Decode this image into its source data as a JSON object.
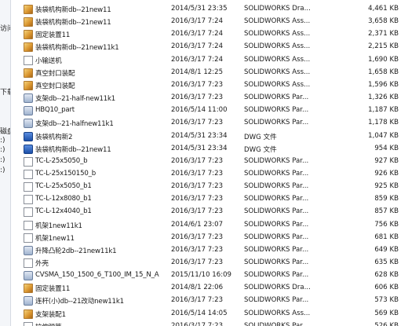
{
  "nav": {
    "items": [
      "访问",
      "下载",
      "磁盘",
      ":)",
      ":)",
      ":)",
      ":)"
    ]
  },
  "colors": {
    "selection": "#cce8ff",
    "nav_bg": "#f4f6f9"
  },
  "files": [
    {
      "name": "装袋机构新db--21new11",
      "date": "2014/5/31 23:35",
      "type": "SOLIDWORKS Dra...",
      "size": "4,461 KB",
      "icon": "solidworks-drawing-icon"
    },
    {
      "name": "装袋机构新db--21new11",
      "date": "2016/3/17 7:24",
      "type": "SOLIDWORKS Ass...",
      "size": "3,658 KB",
      "icon": "solidworks-assembly-icon"
    },
    {
      "name": "固定装置11",
      "date": "2016/3/17 7:24",
      "type": "SOLIDWORKS Ass...",
      "size": "2,371 KB",
      "icon": "solidworks-assembly-icon"
    },
    {
      "name": "装袋机构新db--21new11k1",
      "date": "2016/3/17 7:24",
      "type": "SOLIDWORKS Ass...",
      "size": "2,215 KB",
      "icon": "solidworks-assembly-icon"
    },
    {
      "name": "小输送机",
      "date": "2016/3/17 7:24",
      "type": "SOLIDWORKS Ass...",
      "size": "1,690 KB",
      "icon": "document-icon"
    },
    {
      "name": "真空封口装配",
      "date": "2014/8/1 12:25",
      "type": "SOLIDWORKS Ass...",
      "size": "1,658 KB",
      "icon": "solidworks-assembly-icon"
    },
    {
      "name": "真空封口装配",
      "date": "2016/3/17 7:23",
      "type": "SOLIDWORKS Ass...",
      "size": "1,596 KB",
      "icon": "solidworks-assembly-icon"
    },
    {
      "name": "支架db--21-half-new11k1",
      "date": "2016/3/17 7:23",
      "type": "SOLIDWORKS Par...",
      "size": "1,326 KB",
      "icon": "solidworks-part-icon"
    },
    {
      "name": "HBQ10_part",
      "date": "2016/5/14 11:00",
      "type": "SOLIDWORKS Par...",
      "size": "1,187 KB",
      "icon": "solidworks-part-icon"
    },
    {
      "name": "支架db--21-halfnew11k1",
      "date": "2016/3/17 7:23",
      "type": "SOLIDWORKS Par...",
      "size": "1,178 KB",
      "icon": "solidworks-part-icon"
    },
    {
      "name": "装袋机构新2",
      "date": "2014/5/31 23:34",
      "type": "DWG 文件",
      "size": "1,047 KB",
      "icon": "dwg-file-icon"
    },
    {
      "name": "装袋机构新db--21new11",
      "date": "2014/5/31 23:34",
      "type": "DWG 文件",
      "size": "954 KB",
      "icon": "dwg-file-icon"
    },
    {
      "name": "TC-L-25x5050_b",
      "date": "2016/3/17 7:23",
      "type": "SOLIDWORKS Par...",
      "size": "927 KB",
      "icon": "document-icon"
    },
    {
      "name": "TC-L-25x150150_b",
      "date": "2016/3/17 7:23",
      "type": "SOLIDWORKS Par...",
      "size": "926 KB",
      "icon": "document-icon"
    },
    {
      "name": "TC-L-25x5050_b1",
      "date": "2016/3/17 7:23",
      "type": "SOLIDWORKS Par...",
      "size": "925 KB",
      "icon": "document-icon"
    },
    {
      "name": "TC-L-12x8080_b1",
      "date": "2016/3/17 7:23",
      "type": "SOLIDWORKS Par...",
      "size": "859 KB",
      "icon": "document-icon"
    },
    {
      "name": "TC-L-12x4040_b1",
      "date": "2016/3/17 7:23",
      "type": "SOLIDWORKS Par...",
      "size": "857 KB",
      "icon": "document-icon"
    },
    {
      "name": "机架1new11k1",
      "date": "2014/6/1 23:07",
      "type": "SOLIDWORKS Par...",
      "size": "756 KB",
      "icon": "document-icon"
    },
    {
      "name": "机架1new11",
      "date": "2016/3/17 7:23",
      "type": "SOLIDWORKS Par...",
      "size": "681 KB",
      "icon": "document-icon"
    },
    {
      "name": "升降凸轮2db--21new11k1",
      "date": "2016/3/17 7:23",
      "type": "SOLIDWORKS Par...",
      "size": "649 KB",
      "icon": "solidworks-part-icon"
    },
    {
      "name": "外壳",
      "date": "2016/3/17 7:23",
      "type": "SOLIDWORKS Par...",
      "size": "635 KB",
      "icon": "document-icon"
    },
    {
      "name": "CVSMA_150_1500_6_T100_IM_15_N_A",
      "date": "2015/11/10 16:09",
      "type": "SOLIDWORKS Par...",
      "size": "628 KB",
      "icon": "solidworks-part-icon"
    },
    {
      "name": "固定装置11",
      "date": "2014/8/1 22:06",
      "type": "SOLIDWORKS Dra...",
      "size": "606 KB",
      "icon": "solidworks-assembly-icon"
    },
    {
      "name": "连杆(小)db--21改动new11k1",
      "date": "2016/3/17 7:23",
      "type": "SOLIDWORKS Par...",
      "size": "573 KB",
      "icon": "solidworks-part-icon"
    },
    {
      "name": "支架装配1",
      "date": "2016/5/14 14:05",
      "type": "SOLIDWORKS Ass...",
      "size": "569 KB",
      "icon": "solidworks-assembly-icon"
    },
    {
      "name": "拉伸弹簧",
      "date": "2016/3/17 7:23",
      "type": "SOLIDWORKS Par...",
      "size": "526 KB",
      "icon": "document-icon"
    }
  ]
}
